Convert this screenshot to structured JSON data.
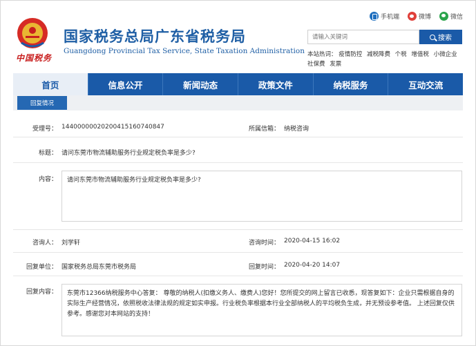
{
  "header": {
    "emblem_logo_text": "中国税务",
    "title": "国家税务总局广东省税务局",
    "subtitle": "Guangdong Provincial Tax Service, State Taxation Administration",
    "top_links": [
      {
        "label": "手机端",
        "icon": "mobile-icon"
      },
      {
        "label": "微博",
        "icon": "weibo-icon"
      },
      {
        "label": "微信",
        "icon": "wechat-icon"
      }
    ],
    "search": {
      "placeholder": "请输入关键词",
      "button_label": "搜索"
    },
    "hot_label": "本站热词：",
    "hot_words": [
      "疫情防控",
      "减税降费",
      "个税",
      "增值税",
      "小微企业",
      "社保费",
      "发票"
    ]
  },
  "nav": {
    "items": [
      "首页",
      "信息公开",
      "新闻动态",
      "政策文件",
      "纳税服务",
      "互动交流"
    ],
    "active_index": 0
  },
  "subnav": {
    "tab_label": "回复情况"
  },
  "form": {
    "accept_no_label": "受理号：",
    "accept_no": "14400000020200415160740847",
    "mailbox_label": "所属信箱：",
    "mailbox": "纳税咨询",
    "title_label": "标题：",
    "title": "请问东莞市物流辅助服务行业规定税负率是多少?",
    "content_label": "内容：",
    "content": "请问东莞市物流辅助服务行业规定税负率是多少?",
    "asker_label": "咨询人：",
    "asker": "刘学轩",
    "ask_time_label": "咨询时间：",
    "ask_time": "2020-04-15 16:02",
    "reply_unit_label": "回复单位：",
    "reply_unit": "国家税务总局东莞市税务局",
    "reply_time_label": "回复时间：",
    "reply_time": "2020-04-20 14:07",
    "reply_content_label": "回复内容：",
    "reply_content": "东莞市12366纳税服务中心答复： 尊敬的纳税人(扣缴义务人、缴费人)您好！您所提交的网上留言已收悉，现答复如下：企业只需根据自身的实际生产经营情况，依照税收法律法规的规定如实申报。行业税负率根据本行业全部纳税人的平均税负生成，并无预设参考值。 上述回复仅供参考。感谢您对本网站的支持！"
  }
}
